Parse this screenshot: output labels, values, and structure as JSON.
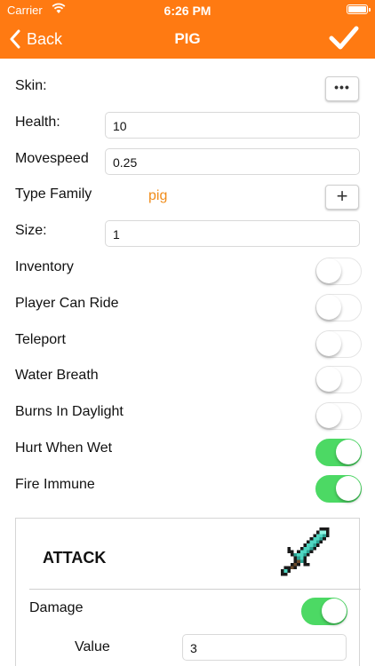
{
  "status": {
    "carrier": "Carrier",
    "time": "6:26 PM"
  },
  "nav": {
    "back_label": "Back",
    "title": "PIG"
  },
  "form": {
    "skin_label": "Skin:",
    "skin_button": "•••",
    "health_label": "Health:",
    "health_value": "10",
    "movespeed_label": "Movespeed",
    "movespeed_value": "0.25",
    "type_family_label": "Type Family",
    "type_family_value": "pig",
    "add_button": "+",
    "size_label": "Size:",
    "size_value": "1",
    "toggles": [
      {
        "label": "Inventory",
        "on": false
      },
      {
        "label": "Player Can Ride",
        "on": false
      },
      {
        "label": "Teleport",
        "on": false
      },
      {
        "label": "Water Breath",
        "on": false
      },
      {
        "label": "Burns In Daylight",
        "on": false
      },
      {
        "label": "Hurt When Wet",
        "on": true
      },
      {
        "label": "Fire Immune",
        "on": true
      }
    ]
  },
  "attack": {
    "title": "ATTACK",
    "damage_label": "Damage",
    "damage_on": true,
    "value_label": "Value",
    "value_value": "3"
  },
  "colors": {
    "accent": "#ff7a12",
    "family_text": "#f08c1a",
    "toggle_on": "#4cd964"
  }
}
